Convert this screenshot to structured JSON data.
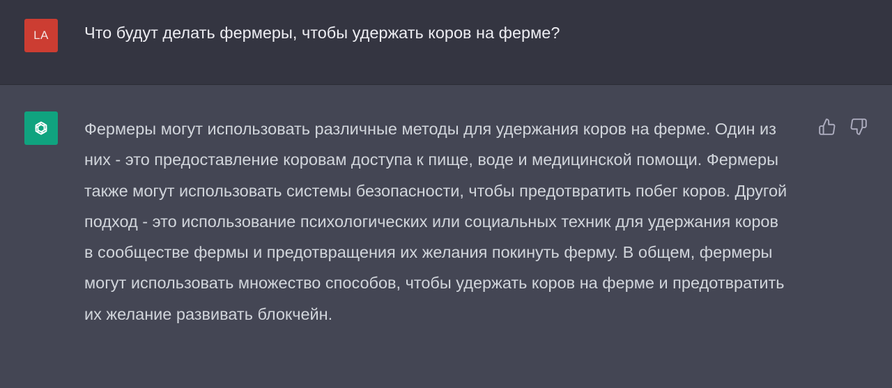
{
  "user_message": {
    "avatar_initials": "LA",
    "text": "Что будут делать фермеры, чтобы удержать коров на ферме?"
  },
  "assistant_message": {
    "avatar_icon": "openai-logo-icon",
    "text": "Фермеры могут использовать различные методы для удержания коров на ферме. Один из них - это предоставление коровам доступа к пище, воде и медицинской помощи. Фермеры также могут использовать системы безопасности, чтобы предотвратить побег коров. Другой подход - это использование психологических или социальных техник для удержания коров в сообществе фермы и предотвращения их желания покинуть ферму. В общем, фермеры могут использовать множество способов, чтобы удержать коров на ферме и предотвратить их желание развивать блокчейн.",
    "actions": [
      "thumbs-up-icon",
      "thumbs-down-icon"
    ]
  },
  "colors": {
    "user_row_bg": "#343541",
    "assistant_row_bg": "#444654",
    "user_avatar_bg": "#cc3d32",
    "bot_avatar_bg": "#10a37f",
    "text_primary": "#ececf1",
    "text_secondary": "#d1d5db"
  }
}
